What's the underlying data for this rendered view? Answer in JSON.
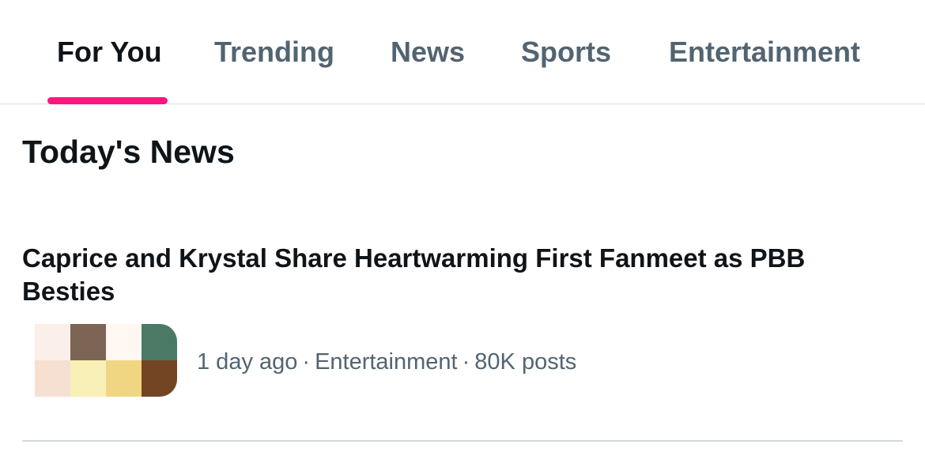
{
  "tabs": [
    {
      "label": "For You",
      "active": true
    },
    {
      "label": "Trending",
      "active": false
    },
    {
      "label": "News",
      "active": false
    },
    {
      "label": "Sports",
      "active": false
    },
    {
      "label": "Entertainment",
      "active": false
    }
  ],
  "colors": {
    "accent": "#f91880",
    "text_primary": "#0f1419",
    "text_secondary": "#536471",
    "divider": "#d4d8dc"
  },
  "section": {
    "title": "Today's News"
  },
  "news_item": {
    "headline": "Caprice and Krystal Share Heartwarming First Fanmeet as PBB Besties",
    "thumbnail_colors": [
      "#fbefea",
      "#7c6454",
      "#fff8f2",
      "#4a7a66",
      "#f5e0d2",
      "#f8f0b6",
      "#f0d682",
      "#744522"
    ],
    "time": "1 day ago",
    "category": "Entertainment",
    "posts": "80K posts",
    "separator": "·"
  }
}
